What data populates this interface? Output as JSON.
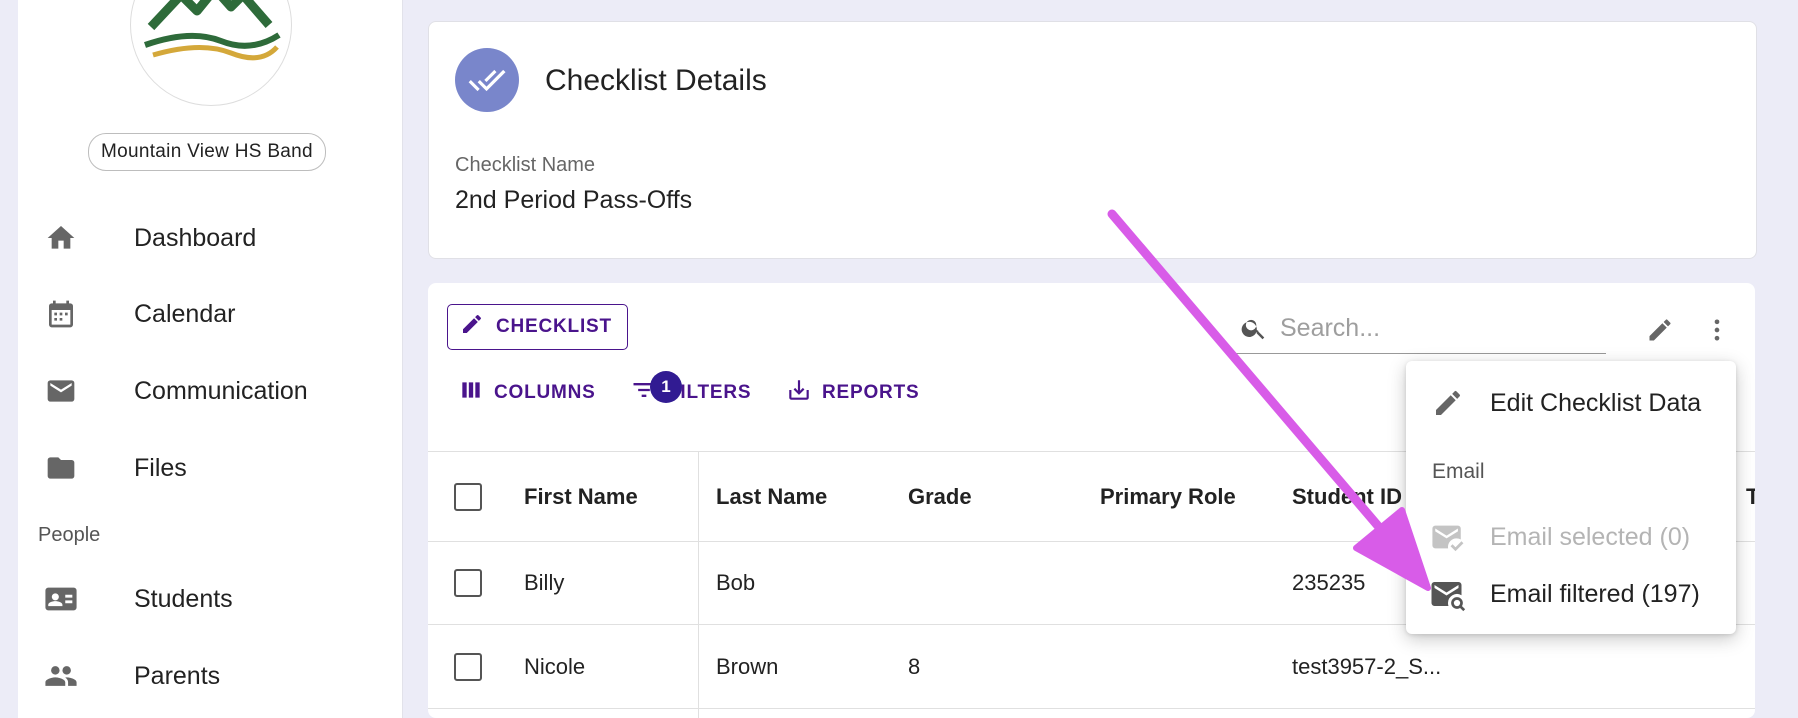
{
  "org": {
    "name": "Mountain View HS Band"
  },
  "sidebar": {
    "items": [
      {
        "label": "Dashboard",
        "icon": "home-icon"
      },
      {
        "label": "Calendar",
        "icon": "calendar-icon"
      },
      {
        "label": "Communication",
        "icon": "mail-icon"
      },
      {
        "label": "Files",
        "icon": "folder-icon"
      }
    ],
    "people_label": "People",
    "people_items": [
      {
        "label": "Students",
        "icon": "id-card-icon"
      },
      {
        "label": "Parents",
        "icon": "people-icon"
      }
    ]
  },
  "details": {
    "title": "Checklist Details",
    "field_label": "Checklist Name",
    "field_value": "2nd Period Pass-Offs"
  },
  "toolbar": {
    "checklist_label": "CHECKLIST",
    "search_placeholder": "Search...",
    "columns_label": "COLUMNS",
    "filters_label": "FILTERS",
    "filters_count": "1",
    "reports_label": "REPORTS"
  },
  "table": {
    "columns": [
      "First Name",
      "Last Name",
      "Grade",
      "Primary Role",
      "Student ID",
      "T"
    ],
    "rows": [
      {
        "first": "Billy",
        "last": "Bob",
        "grade": "",
        "role": "",
        "student_id": "235235"
      },
      {
        "first": "Nicole",
        "last": "Brown",
        "grade": "8",
        "role": "",
        "student_id": "test3957-2_S..."
      }
    ]
  },
  "menu": {
    "edit_label": "Edit Checklist Data",
    "section_label": "Email",
    "email_selected_label": "Email selected (0)",
    "email_filtered_label": "Email filtered (197)"
  },
  "colors": {
    "accent": "#4a148c",
    "badge": "#311b92",
    "avatar": "#7986cb",
    "annotation_arrow": "#d85ce8",
    "background": "#ececf7"
  }
}
